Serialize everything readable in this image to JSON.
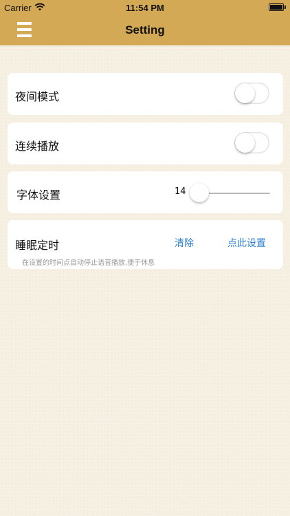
{
  "status_bar": {
    "carrier": "Carrier",
    "time": "11:54 PM",
    "battery_level": 1.0,
    "icons": [
      "wifi-icon",
      "battery-icon"
    ]
  },
  "nav": {
    "title": "Setting",
    "menu_icon": "menu-icon"
  },
  "colors": {
    "nav_background": "#d4a955",
    "page_background": "#f5f0e1",
    "accent": "#2a7fd6"
  },
  "settings": {
    "night_mode": {
      "label": "夜间模式",
      "enabled": false
    },
    "continuous_play": {
      "label": "连续播放",
      "enabled": false
    },
    "font_size": {
      "label": "字体设置",
      "value": "14",
      "level": 0.0
    },
    "sleep_timer": {
      "label": "睡眠定时",
      "clear_label": "清除",
      "set_label": "点此设置",
      "hint": "在设置的时间点自动停止语音播放,便于休息"
    }
  }
}
